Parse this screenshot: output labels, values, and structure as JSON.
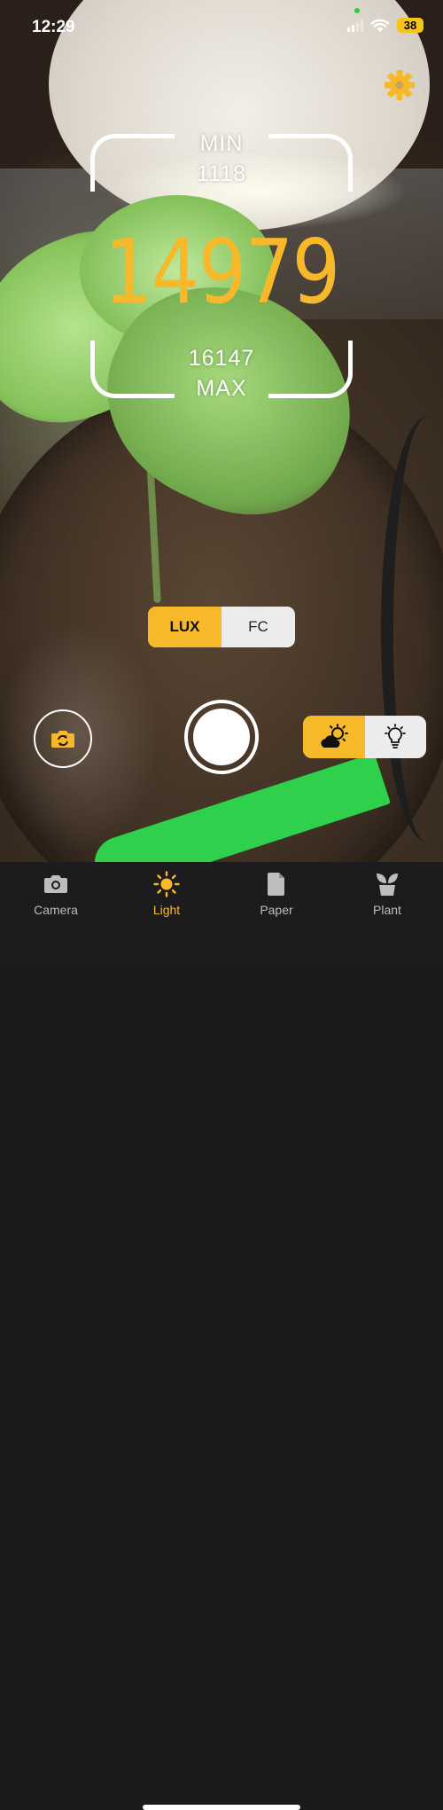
{
  "status": {
    "time": "12:29",
    "battery": "38"
  },
  "meter": {
    "min_label": "MIN",
    "min_value": "1118",
    "reading": "14979",
    "max_value": "16147",
    "max_label": "MAX",
    "accent": "#f7b92a"
  },
  "units": {
    "options": [
      "LUX",
      "FC"
    ],
    "selected": "LUX"
  },
  "light_source": {
    "options": [
      "sun-cloud-icon",
      "bulb-icon"
    ],
    "selected": "sun-cloud-icon"
  },
  "tabs": [
    {
      "label": "Camera",
      "icon": "camera-icon"
    },
    {
      "label": "Light",
      "icon": "sun-icon",
      "active": true
    },
    {
      "label": "Paper",
      "icon": "document-icon"
    },
    {
      "label": "Plant",
      "icon": "plant-icon"
    }
  ]
}
